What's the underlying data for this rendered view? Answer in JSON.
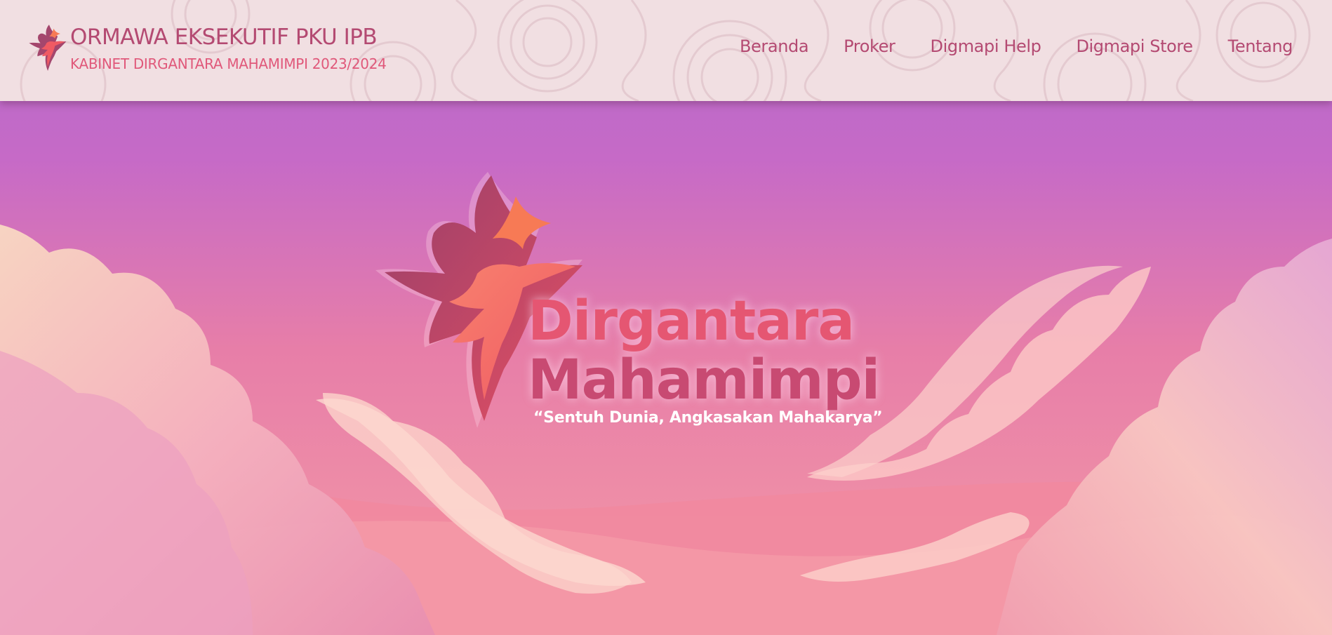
{
  "header": {
    "title": "ORMAWA EKSEKUTIF PKU IPB",
    "subtitle": "KABINET DIRGANTARA MAHAMIMPI 2023/2024",
    "logo_icon": "phoenix-logo-icon"
  },
  "nav": {
    "items": [
      {
        "label": "Beranda"
      },
      {
        "label": "Proker"
      },
      {
        "label": "Digmapi Help"
      },
      {
        "label": "Digmapi Store"
      },
      {
        "label": "Tentang"
      }
    ]
  },
  "hero": {
    "title_line1": "Dirgantara",
    "title_line2": "Mahamimpi",
    "tagline": "“Sentuh Dunia, Angkasakan Mahakarya”",
    "logo_icon": "phoenix-logo-icon"
  },
  "colors": {
    "header_bg": "#f1dfe2",
    "nav_text": "#b44a72",
    "subtitle_text": "#e0587a",
    "sky_top": "#b86fcb",
    "sky_bottom": "#f49aa8",
    "cloud": "#fbc7c9"
  }
}
